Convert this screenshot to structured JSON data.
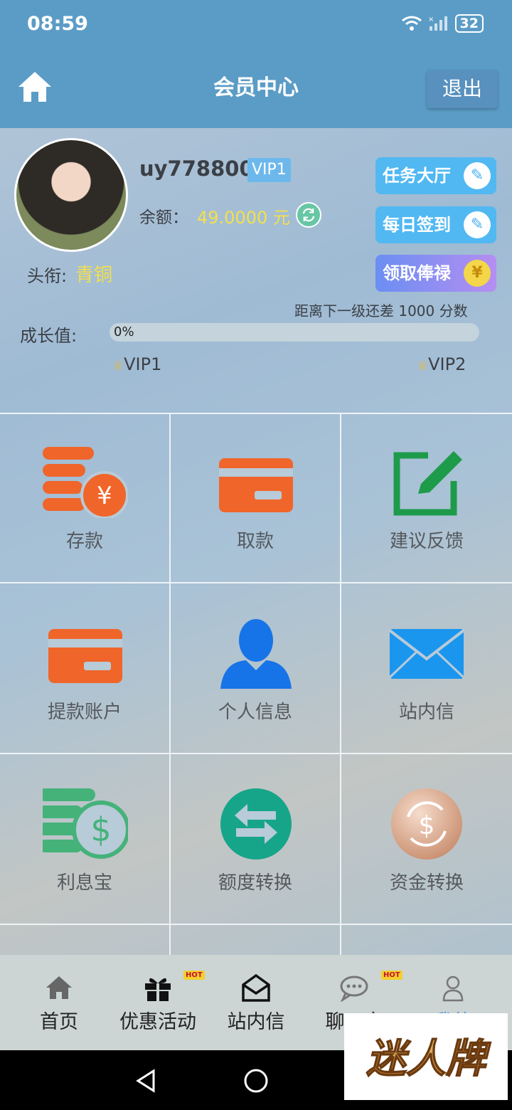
{
  "status_bar": {
    "time": "08:59",
    "battery": "32"
  },
  "header": {
    "title": "会员中心",
    "logout_label": "退出"
  },
  "profile": {
    "username": "uy778800",
    "vip_badge": "VIP1",
    "balance_label": "余额：",
    "balance_value": "49.0000 元",
    "title_label": "头衔:",
    "title_value": "青铜"
  },
  "actions": {
    "task_hall": "任务大厅",
    "daily_signin": "每日签到",
    "claim_salary": "领取俸禄"
  },
  "growth": {
    "next_level_text": "距离下一级还差 1000 分数",
    "label": "成长值:",
    "percent_text": "0%",
    "progress": 0,
    "current_level": "VIP1",
    "next_level": "VIP2"
  },
  "grid": {
    "items": [
      {
        "label": "存款",
        "icon": "deposit-coins-icon"
      },
      {
        "label": "取款",
        "icon": "withdraw-card-icon"
      },
      {
        "label": "建议反馈",
        "icon": "feedback-edit-icon"
      },
      {
        "label": "提款账户",
        "icon": "bank-card-icon"
      },
      {
        "label": "个人信息",
        "icon": "user-icon"
      },
      {
        "label": "站内信",
        "icon": "mail-icon"
      },
      {
        "label": "利息宝",
        "icon": "interest-dollar-icon"
      },
      {
        "label": "额度转换",
        "icon": "transfer-arrows-icon"
      },
      {
        "label": "资金转换",
        "icon": "fund-exchange-icon"
      }
    ]
  },
  "bottom_nav": {
    "items": [
      {
        "label": "首页",
        "icon": "home-icon"
      },
      {
        "label": "优惠活动",
        "icon": "gift-icon",
        "badge": "HOT"
      },
      {
        "label": "站内信",
        "icon": "envelope-open-icon"
      },
      {
        "label": "聊天室",
        "icon": "chat-icon",
        "badge": "HOT"
      },
      {
        "label": "我的",
        "icon": "person-icon"
      }
    ]
  },
  "watermark": {
    "text": "迷人牌"
  },
  "colors": {
    "header": "#5b9cc6",
    "accent_orange": "#f0652a",
    "accent_blue": "#4ab0f0",
    "gold_text": "#f4e04a"
  }
}
